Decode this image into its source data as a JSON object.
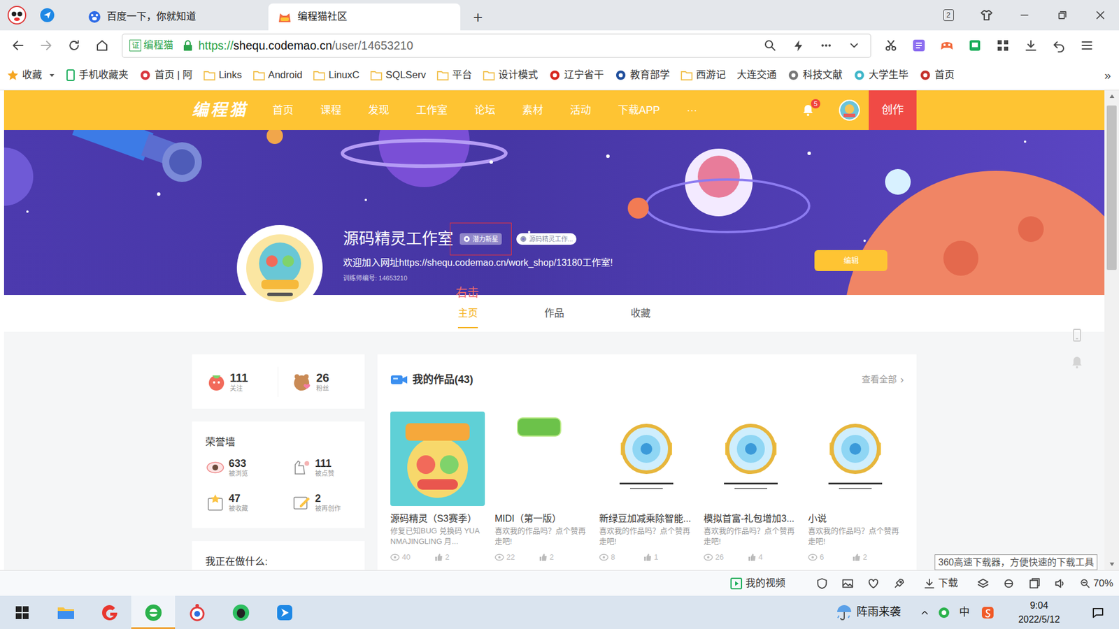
{
  "browser": {
    "tabs": [
      {
        "label": "百度一下，你就知道",
        "selected": false
      },
      {
        "label": "编程猫社区",
        "selected": true
      }
    ],
    "new_tab": "+",
    "tab_count": "2",
    "address": {
      "cert_icon": "证",
      "cert": "编程猫",
      "scheme": "https://",
      "host": "shequ.codemao.cn",
      "path": "/user/14653210"
    },
    "bookmarks": [
      {
        "label": "收藏",
        "kind": "star",
        "color": "#f5a623"
      },
      {
        "label": "手机收藏夹",
        "kind": "mobile",
        "color": "#1aad5a"
      },
      {
        "label": "首页 | 阿",
        "kind": "site",
        "color": "#d9363e"
      },
      {
        "label": "Links",
        "kind": "folder",
        "color": "#f2c14e"
      },
      {
        "label": "Android",
        "kind": "folder",
        "color": "#f2c14e"
      },
      {
        "label": "LinuxC",
        "kind": "folder",
        "color": "#f2c14e"
      },
      {
        "label": "SQLServ",
        "kind": "folder",
        "color": "#f2c14e"
      },
      {
        "label": "平台",
        "kind": "folder",
        "color": "#f2c14e"
      },
      {
        "label": "设计模式",
        "kind": "folder",
        "color": "#f2c14e"
      },
      {
        "label": "辽宁省干",
        "kind": "site",
        "color": "#d7261e"
      },
      {
        "label": "教育部学",
        "kind": "site",
        "color": "#1f4e9c"
      },
      {
        "label": "西游记",
        "kind": "folder",
        "color": "#f2c14e"
      },
      {
        "label": "大连交通",
        "kind": "blank",
        "color": "#ffffff"
      },
      {
        "label": "科技文献",
        "kind": "site",
        "color": "#777777"
      },
      {
        "label": "大学生毕",
        "kind": "site",
        "color": "#3fb6c9"
      },
      {
        "label": "首页",
        "kind": "site",
        "color": "#c4302b"
      }
    ],
    "more_bookmarks": "»"
  },
  "site": {
    "logo": "编程猫",
    "nav": [
      "首页",
      "课程",
      "发现",
      "工作室",
      "论坛",
      "素材",
      "活动",
      "下载APP"
    ],
    "more": "···",
    "notifications": "5",
    "create": "创作"
  },
  "profile": {
    "name": "源码精灵工作室",
    "badges": [
      {
        "label": "潜力新星",
        "annotated": true
      },
      {
        "label": "源码精灵工作...",
        "annotated": false
      }
    ],
    "description": "欢迎加入网址https://shequ.codemao.cn/work_shop/13180工作室!",
    "trainer_id": "训练师编号: 14653210",
    "edit": "编辑",
    "annotation": "右击"
  },
  "tabs": [
    {
      "label": "主页",
      "selected": true
    },
    {
      "label": "作品",
      "selected": false
    },
    {
      "label": "收藏",
      "selected": false
    }
  ],
  "follow_stats": [
    {
      "value": "111",
      "label": "关注"
    },
    {
      "value": "26",
      "label": "粉丝"
    }
  ],
  "honor_wall": {
    "title": "荣誉墙",
    "items": [
      {
        "value": "633",
        "label": "被浏览"
      },
      {
        "value": "111",
        "label": "被点赞"
      },
      {
        "value": "47",
        "label": "被收藏"
      },
      {
        "value": "2",
        "label": "被再创作"
      }
    ]
  },
  "doing": {
    "title": "我正在做什么:"
  },
  "works": {
    "title": "我的作品(43)",
    "view_all": "查看全部",
    "view_all_icon": "›",
    "items": [
      {
        "title": "源码精灵（S3赛季）",
        "description": "修复已知BUG 兑换码 YUANMAJINGLING 月...",
        "views": "40",
        "likes": "2",
        "kind": "cover"
      },
      {
        "title": "MIDI（第一版）",
        "description": "喜欢我的作品吗？点个赞再走吧!",
        "views": "22",
        "likes": "2",
        "kind": "label"
      },
      {
        "title": "新绿豆加减乘除智能...",
        "description": "喜欢我的作品吗？点个赞再走吧!",
        "views": "8",
        "likes": "1",
        "kind": "emblem"
      },
      {
        "title": "模拟首富-礼包增加3...",
        "description": "喜欢我的作品吗？点个赞再走吧!",
        "views": "26",
        "likes": "4",
        "kind": "emblem"
      },
      {
        "title": "小说",
        "description": "喜欢我的作品吗？点个赞再走吧!",
        "views": "6",
        "likes": "2",
        "kind": "emblem"
      }
    ]
  },
  "scrollbar": {
    "level": 0.36
  },
  "tooltip": "360高速下载器，方便快速的下载工具",
  "status_bar": {
    "video": "我的视频",
    "download": "下载",
    "zoom": "70%"
  },
  "taskbar": {
    "weather": "阵雨来袭",
    "ime": "中",
    "time": "9:04",
    "date": "2022/5/12"
  }
}
